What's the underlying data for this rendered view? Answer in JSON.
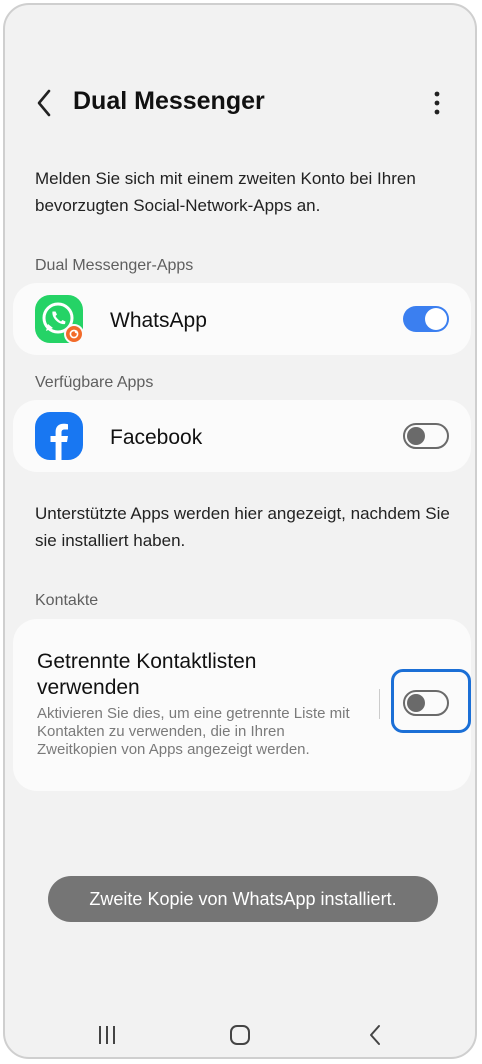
{
  "header": {
    "title": "Dual Messenger"
  },
  "description": "Melden Sie sich mit einem zweiten Konto bei Ihren bevorzugten Social-Network-Apps an.",
  "sections": {
    "dual_apps": {
      "label": "Dual Messenger-Apps",
      "app": {
        "name": "WhatsApp",
        "icon": "whatsapp-icon",
        "enabled": true
      }
    },
    "available_apps": {
      "label": "Verfügbare Apps",
      "app": {
        "name": "Facebook",
        "icon": "facebook-icon",
        "enabled": false
      }
    },
    "note": "Unterstützte Apps werden hier angezeigt, nachdem Sie sie installiert haben.",
    "contacts": {
      "label": "Kontakte",
      "title": "Getrennte Kontaktlisten verwenden",
      "subtitle": "Aktivieren Sie dies, um eine getrennte Liste mit Kontakten zu verwenden, die in Ihren Zweitkopien von Apps angezeigt werden.",
      "enabled": false
    }
  },
  "toast": "Zweite Kopie von WhatsApp installiert.",
  "colors": {
    "accent": "#3b7ff0",
    "highlight": "#1b6fd6",
    "whatsapp": "#25d366",
    "facebook": "#1877f2",
    "badge": "#f26b2a"
  }
}
